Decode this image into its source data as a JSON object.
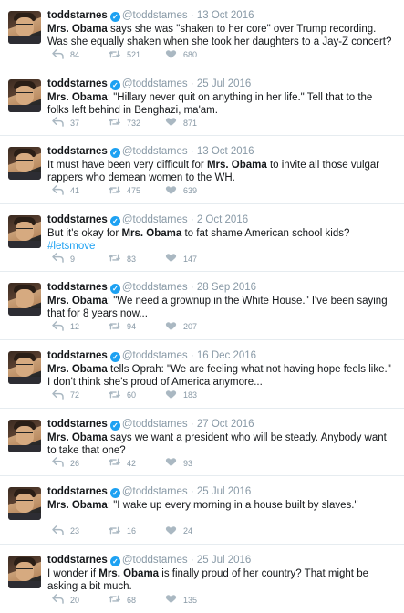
{
  "tweets": [
    {
      "name": "toddstarnes",
      "handle": "@toddstarnes",
      "date": "13 Oct 2016",
      "text": [
        {
          "t": "Mrs. Obama",
          "b": true
        },
        {
          "t": " says she was \"shaken to her core\" over Trump recording. Was she equally shaken when she took her daughters to a Jay-Z concert?"
        }
      ],
      "replies": "84",
      "retweets": "521",
      "likes": "680"
    },
    {
      "name": "toddstarnes",
      "handle": "@toddstarnes",
      "date": "25 Jul 2016",
      "text": [
        {
          "t": "Mrs. Obama",
          "b": true
        },
        {
          "t": ": \"Hillary never quit on anything in her life.\" Tell that to the folks left behind in Benghazi, ma'am."
        }
      ],
      "replies": "37",
      "retweets": "732",
      "likes": "871"
    },
    {
      "name": "toddstarnes",
      "handle": "@toddstarnes",
      "date": "13 Oct 2016",
      "text": [
        {
          "t": "It must have been very difficult for "
        },
        {
          "t": "Mrs. Obama",
          "b": true
        },
        {
          "t": " to invite all those vulgar rappers who demean women to the WH."
        }
      ],
      "replies": "41",
      "retweets": "475",
      "likes": "639"
    },
    {
      "name": "toddstarnes",
      "handle": "@toddstarnes",
      "date": "2 Oct 2016",
      "text": [
        {
          "t": "But it's okay for "
        },
        {
          "t": "Mrs. Obama",
          "b": true
        },
        {
          "t": " to fat shame American school kids? "
        },
        {
          "t": "#letsmove",
          "h": true
        }
      ],
      "replies": "9",
      "retweets": "83",
      "likes": "147"
    },
    {
      "name": "toddstarnes",
      "handle": "@toddstarnes",
      "date": "28 Sep 2016",
      "text": [
        {
          "t": "Mrs. Obama",
          "b": true
        },
        {
          "t": ": \"We need a grownup in the White House.\" I've been saying that for 8 years now..."
        }
      ],
      "replies": "12",
      "retweets": "94",
      "likes": "207"
    },
    {
      "name": "toddstarnes",
      "handle": "@toddstarnes",
      "date": "16 Dec 2016",
      "text": [
        {
          "t": "Mrs. Obama",
          "b": true
        },
        {
          "t": " tells Oprah: \"We are feeling what not having hope feels like.\" I don't think she's proud of America anymore..."
        }
      ],
      "replies": "72",
      "retweets": "60",
      "likes": "183"
    },
    {
      "name": "toddstarnes",
      "handle": "@toddstarnes",
      "date": "27 Oct 2016",
      "text": [
        {
          "t": "Mrs. Obama",
          "b": true
        },
        {
          "t": " says we want a president who will be steady. Anybody want to take that one?"
        }
      ],
      "replies": "26",
      "retweets": "42",
      "likes": "93"
    },
    {
      "name": "toddstarnes",
      "handle": "@toddstarnes",
      "date": "25 Jul 2016",
      "text": [
        {
          "t": "Mrs. Obama",
          "b": true
        },
        {
          "t": ": \"I wake up every morning in a house built by slaves.\""
        }
      ],
      "replies": "23",
      "retweets": "16",
      "likes": "24"
    },
    {
      "name": "toddstarnes",
      "handle": "@toddstarnes",
      "date": "25 Jul 2016",
      "text": [
        {
          "t": "I wonder if "
        },
        {
          "t": "Mrs. Obama",
          "b": true
        },
        {
          "t": " is finally proud of her country? That might be asking a bit much."
        }
      ],
      "replies": "20",
      "retweets": "68",
      "likes": "135"
    }
  ],
  "icons": {
    "reply": "reply-icon",
    "retweet": "retweet-icon",
    "like": "heart-icon",
    "verified": "verified-badge-icon"
  },
  "colors": {
    "text": "#14171a",
    "muted": "#8899a6",
    "accent": "#1da1f2",
    "divider": "#e6ecf0"
  }
}
